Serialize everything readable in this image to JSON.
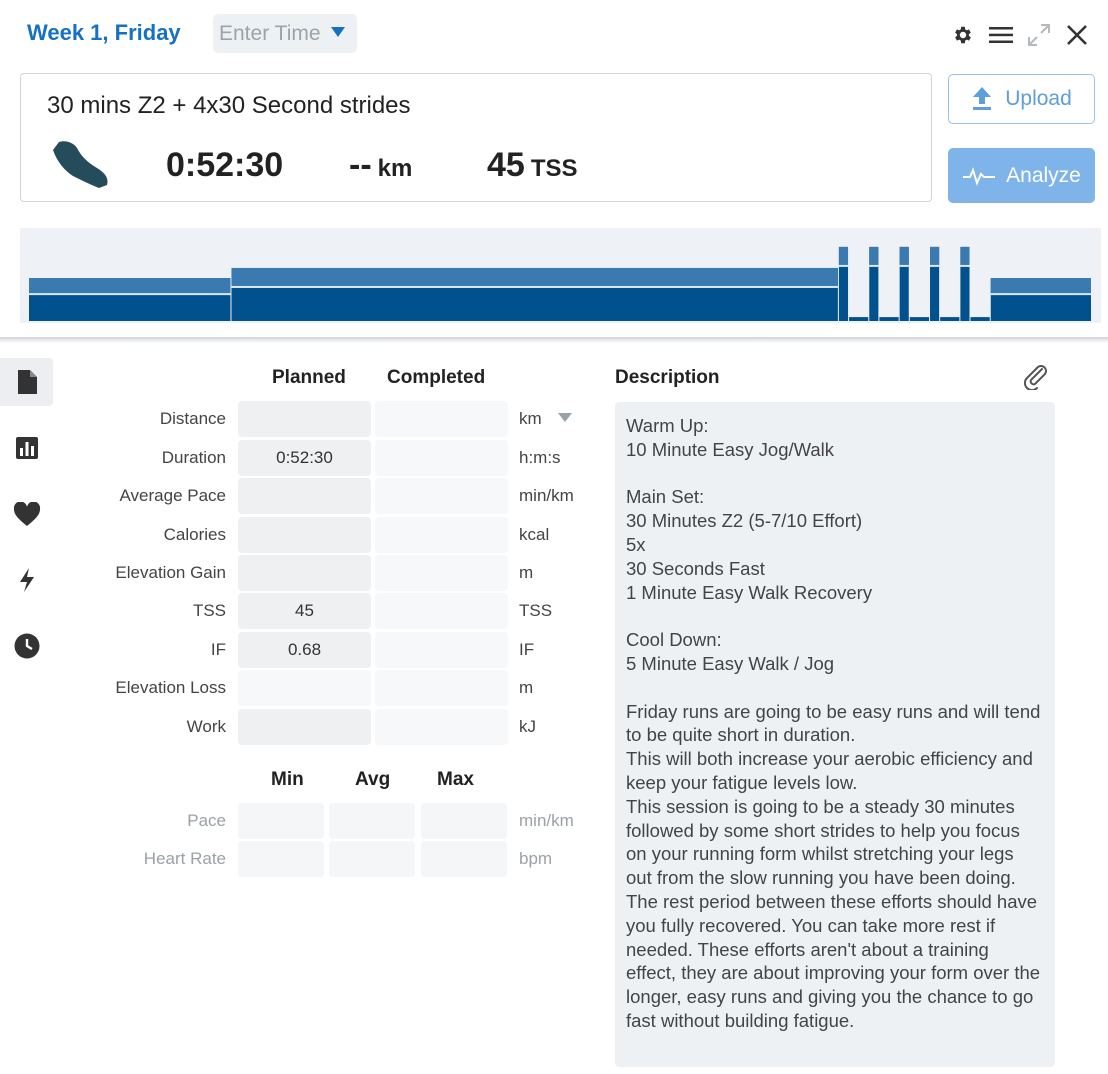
{
  "header": {
    "title": "Week 1, Friday",
    "time_placeholder": "Enter Time"
  },
  "workout": {
    "title": "30 mins Z2 + 4x30 Second strides",
    "duration": "0:52:30",
    "distance_value": "--",
    "distance_unit": "km",
    "tss_value": "45",
    "tss_unit": "TSS"
  },
  "buttons": {
    "upload": "Upload",
    "analyze": "Analyze"
  },
  "chart_data": {
    "type": "area",
    "colors": {
      "fill": "#02518f",
      "band": "#3a7ab0",
      "background": "#eef2f7"
    },
    "segments_minutes": [
      {
        "start": 0,
        "end": 10,
        "level": 0.55
      },
      {
        "start": 10,
        "end": 40,
        "level": 0.68
      },
      {
        "start": 40,
        "end": 40.5,
        "level": 0.95
      },
      {
        "start": 40.5,
        "end": 41.5,
        "level": 0.05
      },
      {
        "start": 41.5,
        "end": 42,
        "level": 0.95
      },
      {
        "start": 42,
        "end": 43,
        "level": 0.05
      },
      {
        "start": 43,
        "end": 43.5,
        "level": 0.95
      },
      {
        "start": 43.5,
        "end": 44.5,
        "level": 0.05
      },
      {
        "start": 44.5,
        "end": 45,
        "level": 0.95
      },
      {
        "start": 45,
        "end": 46,
        "level": 0.05
      },
      {
        "start": 46,
        "end": 46.5,
        "level": 0.95
      },
      {
        "start": 46.5,
        "end": 47.5,
        "level": 0.05
      },
      {
        "start": 47.5,
        "end": 52.5,
        "level": 0.55
      }
    ]
  },
  "sidebar": {
    "icons": [
      "document-icon",
      "bar-chart-icon",
      "heart-icon",
      "lightning-icon",
      "clock-icon"
    ]
  },
  "table": {
    "planned_header": "Planned",
    "completed_header": "Completed",
    "rows": [
      {
        "label": "Distance",
        "planned": "",
        "completed": "",
        "unit": "km"
      },
      {
        "label": "Duration",
        "planned": "0:52:30",
        "completed": "",
        "unit": "h:m:s"
      },
      {
        "label": "Average Pace",
        "planned": "",
        "completed": "",
        "unit": "min/km"
      },
      {
        "label": "Calories",
        "planned": "",
        "completed": "",
        "unit": "kcal"
      },
      {
        "label": "Elevation Gain",
        "planned": "",
        "completed": "",
        "unit": "m"
      },
      {
        "label": "TSS",
        "planned": "45",
        "completed": "",
        "unit": "TSS"
      },
      {
        "label": "IF",
        "planned": "0.68",
        "completed": "",
        "unit": "IF"
      },
      {
        "label": "Elevation Loss",
        "planned": "",
        "completed": "",
        "unit": "m"
      },
      {
        "label": "Work",
        "planned": "",
        "completed": "",
        "unit": "kJ"
      }
    ],
    "min_header": "Min",
    "avg_header": "Avg",
    "max_header": "Max",
    "range_rows": [
      {
        "label": "Pace",
        "unit": "min/km"
      },
      {
        "label": "Heart Rate",
        "unit": "bpm"
      }
    ]
  },
  "description": {
    "header": "Description",
    "text": "Warm Up:\n10 Minute Easy Jog/Walk\n\nMain Set:\n30 Minutes Z2 (5-7/10 Effort)\n5x\n30 Seconds Fast\n1 Minute Easy Walk Recovery\n\nCool Down:\n5 Minute Easy Walk / Jog\n\nFriday runs are going to be easy runs and will tend to be quite short in duration.\nThis will both increase your aerobic efficiency and keep your fatigue levels low.\nThis session is going to be a steady 30 minutes followed by some short strides to help you focus on your running form whilst stretching your legs out from the slow running you have been doing.\nThe rest period between these efforts should have you fully recovered. You can take more rest if needed. These efforts aren't about a training effect, they are about improving your form over the longer, easy runs and giving you the chance to go fast without building fatigue."
  }
}
